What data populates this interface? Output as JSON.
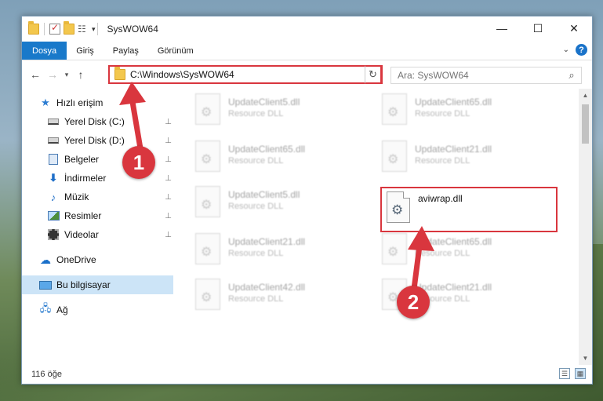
{
  "window": {
    "title": "SysWOW64",
    "minimize_glyph": "—",
    "maximize_glyph": "☐",
    "close_glyph": "✕"
  },
  "ribbon": {
    "tabs": [
      {
        "label": "Dosya"
      },
      {
        "label": "Giriş"
      },
      {
        "label": "Paylaş"
      },
      {
        "label": "Görünüm"
      }
    ],
    "help_glyph": "?"
  },
  "nav": {
    "back": "←",
    "forward": "→",
    "recent": "▾",
    "up": "↑",
    "address": "C:\\Windows\\SysWOW64",
    "address_dropdown": "⌄",
    "refresh": "↻",
    "search_placeholder": "Ara: SysWOW64",
    "search_icon": "⌕"
  },
  "sidebar": {
    "quick_access": "Hızlı erişim",
    "items": [
      {
        "label": "Yerel Disk (C:)",
        "icon": "disk-icon"
      },
      {
        "label": "Yerel Disk (D:)",
        "icon": "disk-icon"
      },
      {
        "label": "Belgeler",
        "icon": "documents-icon"
      },
      {
        "label": "İndirmeler",
        "icon": "downloads-icon"
      },
      {
        "label": "Müzik",
        "icon": "music-icon"
      },
      {
        "label": "Resimler",
        "icon": "pictures-icon"
      },
      {
        "label": "Videolar",
        "icon": "videos-icon"
      }
    ],
    "onedrive": "OneDrive",
    "this_pc": "Bu bilgisayar",
    "network": "Ağ",
    "pin_glyph": "📌"
  },
  "files": {
    "blurred": [
      {
        "name": "UpdateClient5.dll",
        "type": "Resource DLL"
      },
      {
        "name": "UpdateClient65.dll",
        "type": "Resource DLL"
      },
      {
        "name": "UpdateClient65.dll",
        "type": "Resource DLL"
      },
      {
        "name": "UpdateClient21.dll",
        "type": "Resource DLL"
      },
      {
        "name": "UpdateClient5.dll",
        "type": "Resource DLL"
      },
      {
        "name": "UpdateClient21.dll",
        "type": "Resource DLL"
      },
      {
        "name": "UpdateClient65.dll",
        "type": "Resource DLL"
      },
      {
        "name": "UpdateClient42.dll",
        "type": "Resource DLL"
      },
      {
        "name": "UpdateClient21.dll",
        "type": "Resource DLL"
      }
    ],
    "target": {
      "name": "aviwrap.dll"
    }
  },
  "status": {
    "item_count": "116 öğe"
  },
  "annotations": {
    "step1": "1",
    "step2": "2",
    "color": "#d9363e"
  }
}
